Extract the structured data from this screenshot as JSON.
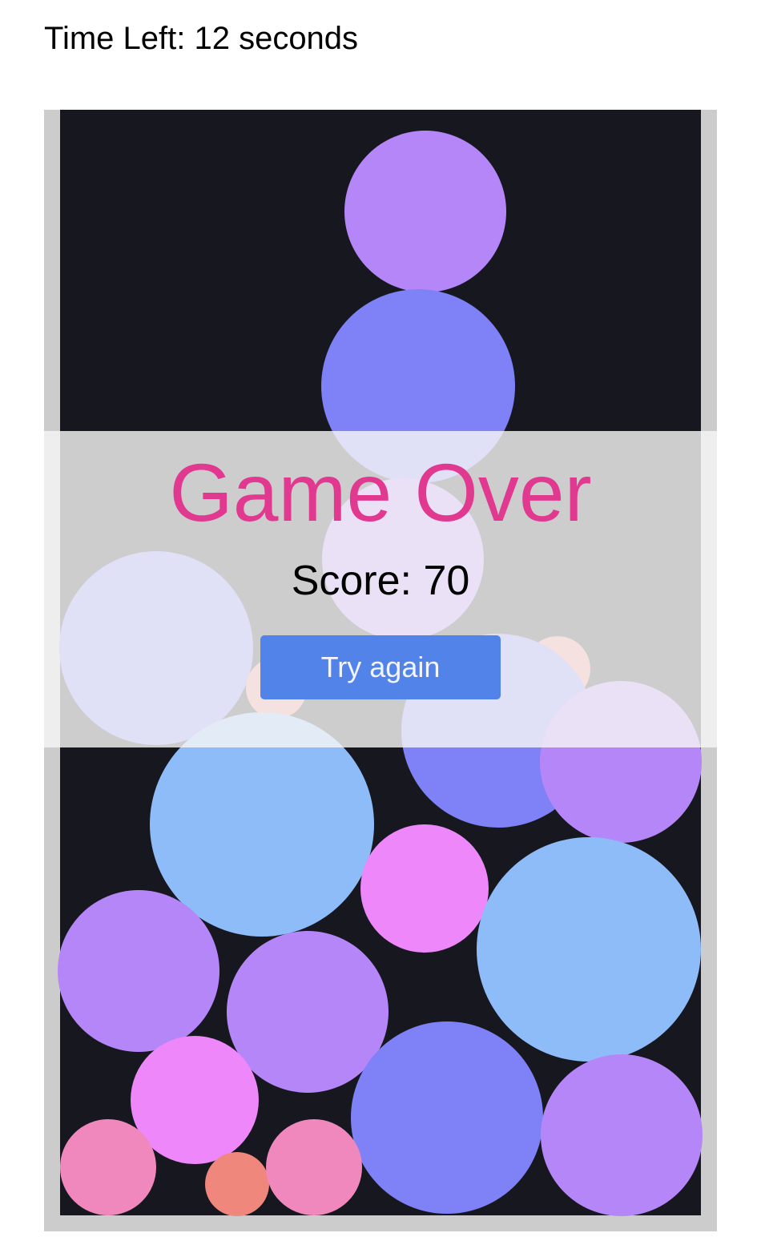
{
  "header": {
    "timer_text": "Time Left: 12 seconds"
  },
  "colors": {
    "board_border": "#cccccc",
    "board_background": "#171720",
    "overlay_title": "#e0398f",
    "button_background": "#5283e8",
    "ball_palette": [
      "#b586f8",
      "#7f81f6",
      "#8dbcf9",
      "#ee87fa",
      "#f088be",
      "#f0877d"
    ]
  },
  "game_over": {
    "title": "Game Over",
    "score_text": "Score: 70",
    "button_label": "Try again"
  }
}
